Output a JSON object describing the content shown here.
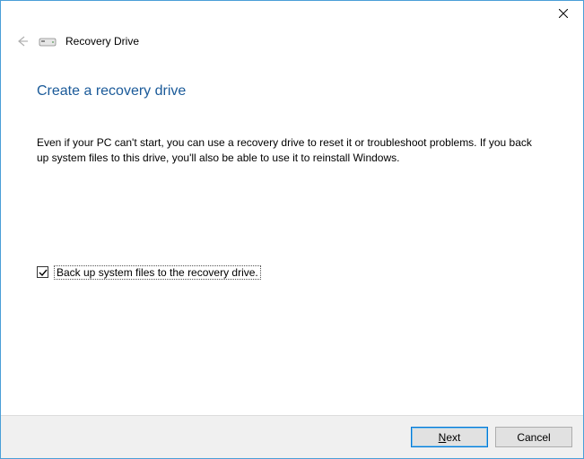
{
  "titlebar": {
    "close_label": "Close"
  },
  "header": {
    "back_label": "Back",
    "window_title": "Recovery Drive"
  },
  "main": {
    "heading": "Create a recovery drive",
    "description": "Even if your PC can't start, you can use a recovery drive to reset it or troubleshoot problems. If you back up system files to this drive, you'll also be able to use it to reinstall Windows.",
    "checkbox": {
      "checked": true,
      "label": "Back up system files to the recovery drive."
    }
  },
  "footer": {
    "next_prefix": "N",
    "next_rest": "ext",
    "cancel_label": "Cancel"
  }
}
